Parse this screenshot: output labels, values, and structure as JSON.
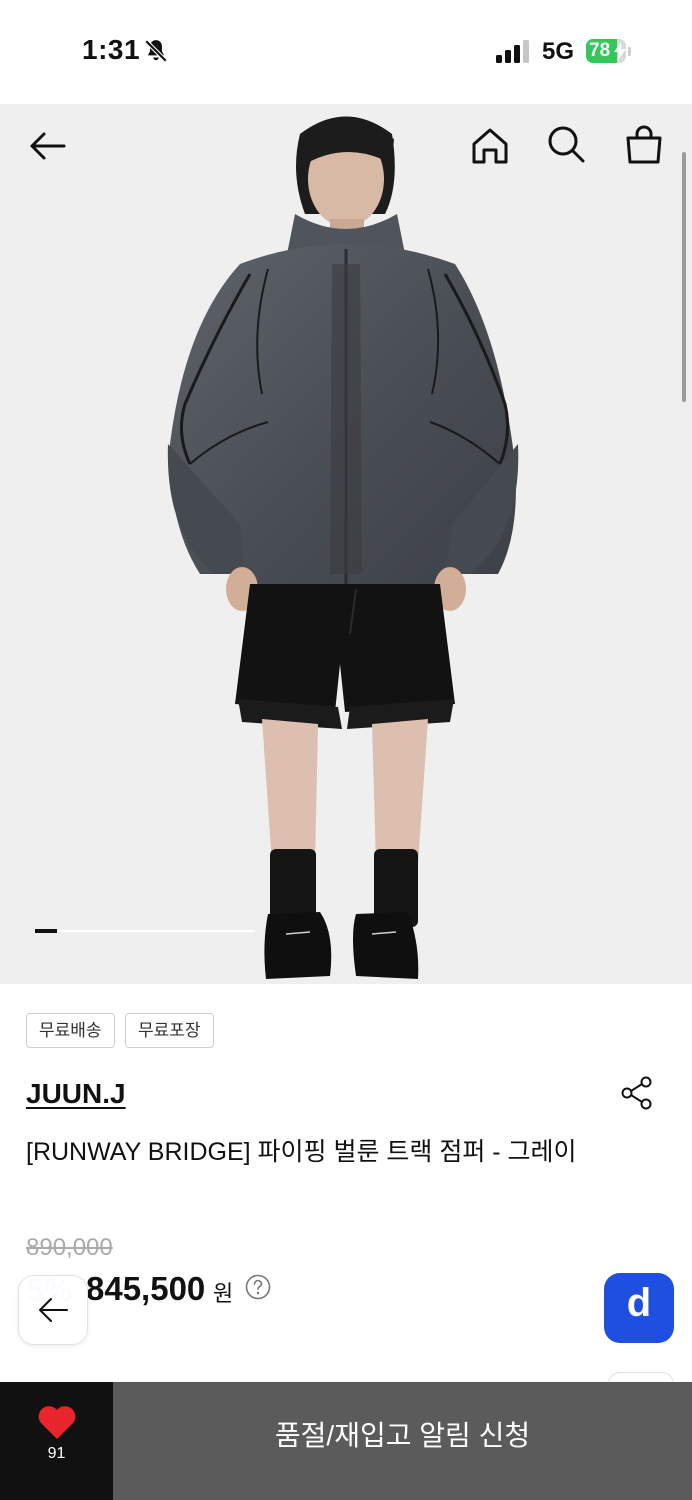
{
  "status_bar": {
    "time": "1:31",
    "network": "5G",
    "battery_level": "78",
    "battery_fraction": 0.78,
    "battery_color": "#34c759",
    "icons": [
      "bell-slash-icon",
      "cellular-signal-icon",
      "battery-charging-icon"
    ]
  },
  "header": {
    "icons": [
      "back-arrow-icon",
      "home-icon",
      "search-icon",
      "shopping-bag-icon"
    ]
  },
  "gallery": {
    "image_description_icon": "product-photo",
    "active_page_fraction": 0.1
  },
  "product": {
    "tags": [
      "무료배송",
      "무료포장"
    ],
    "brand": "JUUN.J",
    "title": "[RUNWAY BRIDGE] 파이핑 벌룬 트랙 점퍼 - 그레이",
    "original_price": "890,000",
    "discount": "5%",
    "price": "845,500",
    "currency": "원",
    "help_icon": "question-circle-icon",
    "share_icon": "share-icon"
  },
  "floating": {
    "back_icon": "back-arrow-icon",
    "d_button_label": "d",
    "d_button_color": "#1f4fe0"
  },
  "bottom_bar": {
    "like_count": "91",
    "heart_color": "#e8262b",
    "restock_label": "품절/재입고 알림 신청"
  }
}
